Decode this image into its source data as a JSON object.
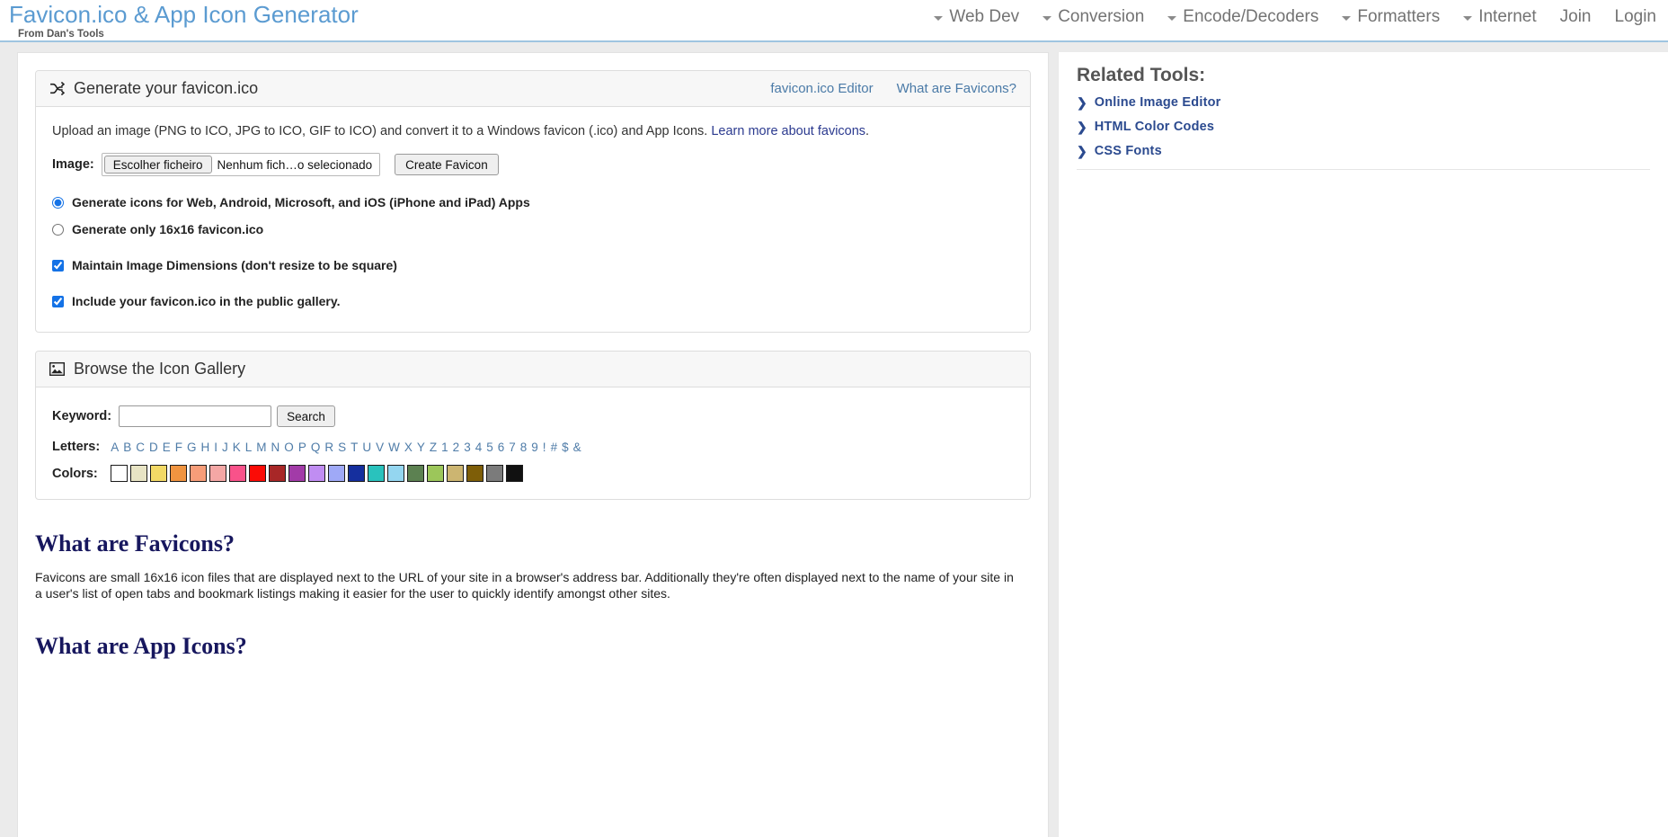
{
  "brand": {
    "title": "Favicon.ico & App Icon Generator",
    "subtitle": "From Dan's Tools"
  },
  "nav": {
    "items": [
      {
        "label": "Web Dev",
        "caret": true,
        "icon": "chevron-down-icon"
      },
      {
        "label": "Conversion",
        "caret": true,
        "icon": "chevron-down-icon"
      },
      {
        "label": "Encode/Decoders",
        "caret": true,
        "icon": "chevron-down-icon"
      },
      {
        "label": "Formatters",
        "caret": true,
        "icon": "chevron-down-icon"
      },
      {
        "label": "Internet",
        "caret": true,
        "icon": "chevron-down-icon"
      },
      {
        "label": "Join",
        "caret": false,
        "icon": ""
      },
      {
        "label": "Login",
        "caret": false,
        "icon": ""
      }
    ]
  },
  "generator": {
    "icon": "shuffle-icon",
    "title": "Generate your favicon.ico",
    "links": [
      {
        "label": "favicon.ico Editor"
      },
      {
        "label": "What are Favicons?"
      }
    ],
    "description_before": "Upload an image (PNG to ICO, JPG to ICO, GIF to ICO) and convert it to a Windows favicon (.ico) and App Icons. ",
    "description_link": "Learn more about favicons",
    "description_after": ".",
    "image_label": "Image:",
    "file_button_label": "Escolher ficheiro",
    "file_name_text": "Nenhum fich…o selecionado",
    "create_button_label": "Create Favicon",
    "options": [
      {
        "type": "radio",
        "checked": true,
        "label": "Generate icons for Web, Android, Microsoft, and iOS (iPhone and iPad) Apps"
      },
      {
        "type": "radio",
        "checked": false,
        "label": "Generate only 16x16 favicon.ico"
      },
      {
        "type": "checkbox",
        "checked": true,
        "label": "Maintain Image Dimensions (don't resize to be square)"
      },
      {
        "type": "checkbox",
        "checked": true,
        "label": "Include your favicon.ico in the public gallery."
      }
    ]
  },
  "gallery": {
    "icon": "image-icon",
    "title": "Browse the Icon Gallery",
    "keyword_label": "Keyword:",
    "keyword_value": "",
    "keyword_placeholder": "",
    "search_button_label": "Search",
    "letters_label": "Letters:",
    "letters": [
      "A",
      "B",
      "C",
      "D",
      "E",
      "F",
      "G",
      "H",
      "I",
      "J",
      "K",
      "L",
      "M",
      "N",
      "O",
      "P",
      "Q",
      "R",
      "S",
      "T",
      "U",
      "V",
      "W",
      "X",
      "Y",
      "Z",
      "1",
      "2",
      "3",
      "4",
      "5",
      "6",
      "7",
      "8",
      "9",
      "!",
      "#",
      "$",
      "&"
    ],
    "colors_label": "Colors:",
    "colors": [
      "#ffffff",
      "#e8e4c4",
      "#f2d966",
      "#f09440",
      "#f79d79",
      "#f4a7a5",
      "#f9528a",
      "#fb0b06",
      "#a82727",
      "#a23ba8",
      "#c08df2",
      "#9fa9f7",
      "#152f9e",
      "#29c2bd",
      "#94d6f0",
      "#5c8151",
      "#9cc65a",
      "#ccb571",
      "#7e5e08",
      "#7b7b7b",
      "#111111"
    ]
  },
  "articles": [
    {
      "heading": "What are Favicons?",
      "body": "Favicons are small 16x16 icon files that are displayed next to the URL of your site in a browser's address bar. Additionally they're often displayed next to the name of your site in a user's list of open tabs and bookmark listings making it easier for the user to quickly identify amongst other sites."
    },
    {
      "heading": "What are App Icons?",
      "body": ""
    }
  ],
  "sidebar": {
    "title": "Related Tools:",
    "items": [
      {
        "label": "Online Image Editor",
        "icon": "chevron-right-icon"
      },
      {
        "label": "HTML Color Codes",
        "icon": "chevron-right-icon"
      },
      {
        "label": "CSS Fonts",
        "icon": "chevron-right-icon"
      }
    ]
  }
}
